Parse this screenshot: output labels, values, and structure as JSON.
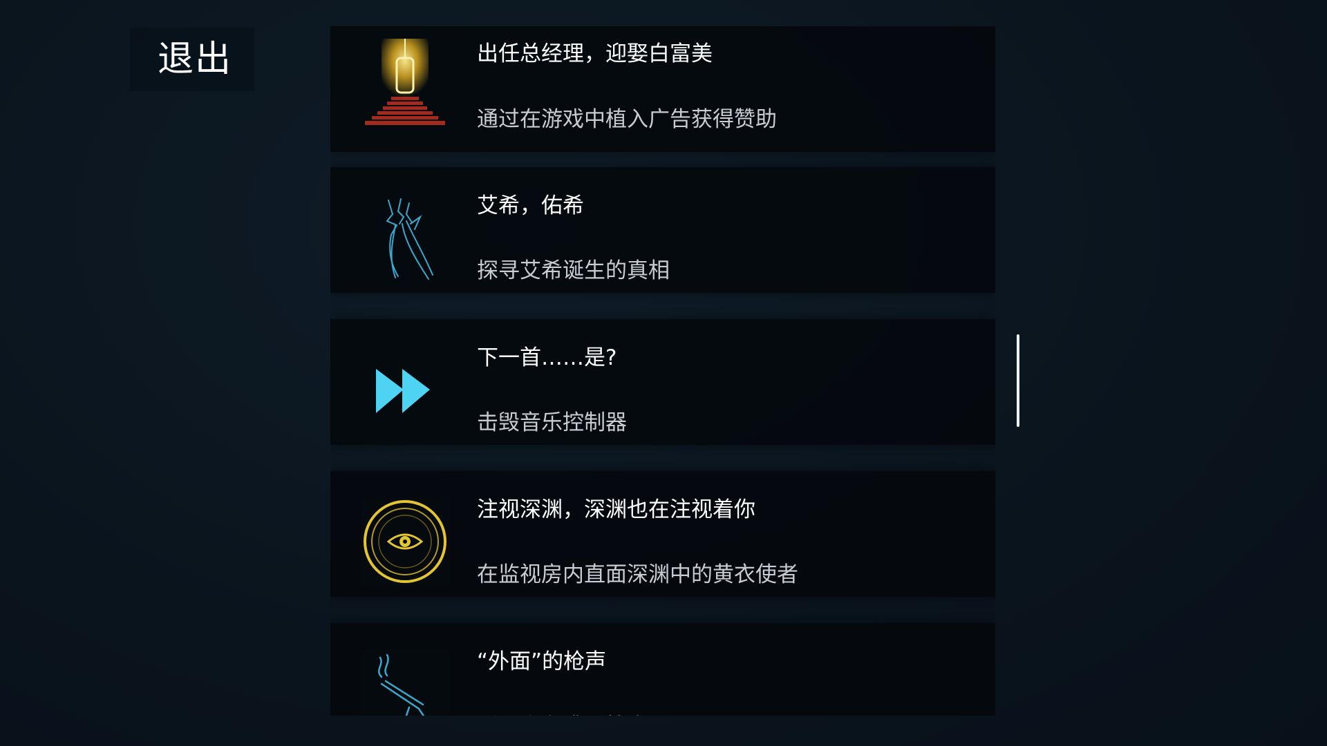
{
  "exit_button": {
    "label": "退出"
  },
  "achievements": [
    {
      "icon": "golden-door-icon",
      "title": "出任总经理，迎娶白富美",
      "description": "通过在游戏中植入广告获得赞助"
    },
    {
      "icon": "winged-blade-icon",
      "title": "艾希，佑希",
      "description": "探寻艾希诞生的真相"
    },
    {
      "icon": "fast-forward-icon",
      "title": "下一首……是?",
      "description": "击毁音乐控制器"
    },
    {
      "icon": "eye-circle-icon",
      "title": "注视深渊，深渊也在注视着你",
      "description": "在监视房内直面深渊中的黄衣使者"
    },
    {
      "icon": "smoking-gun-icon",
      "title": "“外面”的枪声",
      "description": "适用宇在遭到枪击"
    }
  ],
  "colors": {
    "background": "#0b1620",
    "card": "#04080c",
    "title_text": "#ffffff",
    "description_text": "#c9ccd0",
    "cyan_accent": "#3fc3e6",
    "gold_accent": "#e2c531",
    "red_accent": "#c0392b"
  }
}
